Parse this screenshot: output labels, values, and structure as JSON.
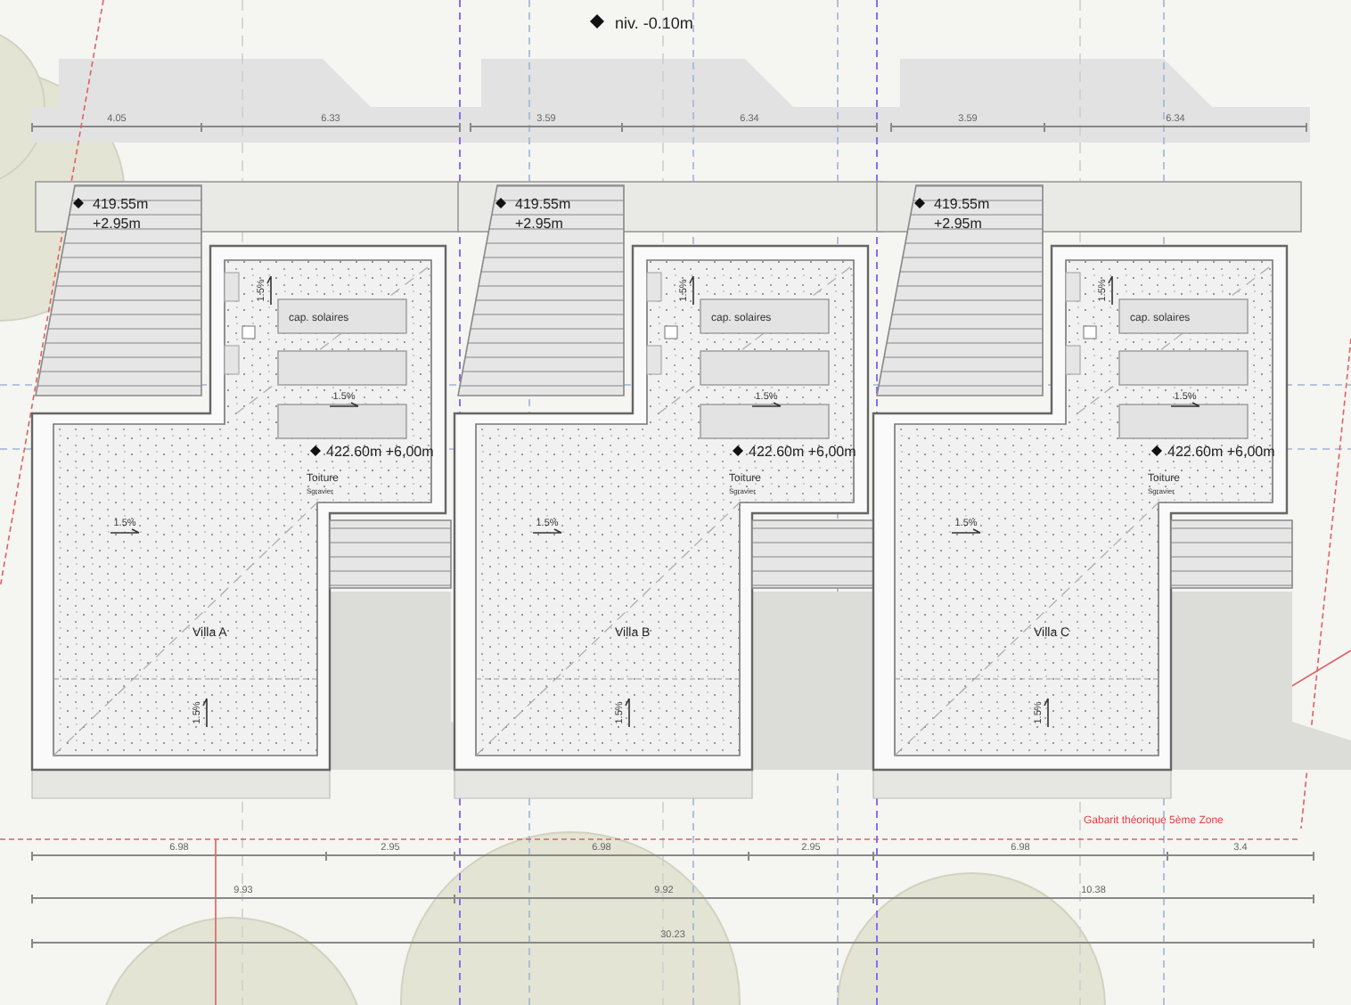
{
  "level_marker": {
    "text": "niv. -0.10m"
  },
  "top_dimensions": [
    "4.05",
    "6.33",
    "3.59",
    "6.34",
    "3.59",
    "6.34"
  ],
  "villas": [
    {
      "name": "Villa A",
      "terrace_level": "419.55m",
      "terrace_height": "+2.95m",
      "solar_label": "cap. solaires",
      "roof_level": "422.60m +6,00m",
      "roof_label": "Toiture",
      "roof_material": "Sgravier",
      "slopes": [
        "1.5%",
        "1.5%",
        "1.5%",
        "1.5%"
      ]
    },
    {
      "name": "Villa B",
      "terrace_level": "419.55m",
      "terrace_height": "+2.95m",
      "solar_label": "cap. solaires",
      "roof_level": "422.60m +6,00m",
      "roof_label": "Toiture",
      "roof_material": "Sgravier",
      "slopes": [
        "1.5%",
        "1.5%",
        "1.5%",
        "1.5%"
      ]
    },
    {
      "name": "Villa C",
      "terrace_level": "419.55m",
      "terrace_height": "+2.95m",
      "solar_label": "cap. solaires",
      "roof_level": "422.60m +6,00m",
      "roof_label": "Toiture",
      "roof_material": "Sgravier",
      "slopes": [
        "1.5%",
        "1.5%",
        "1.5%",
        "1.5%"
      ]
    }
  ],
  "bottom_dimensions": {
    "row_1": [
      "6.98",
      "2.95",
      "6.98",
      "2.95",
      "6.98",
      "3.4"
    ],
    "row_2": [
      "9.93",
      "9.92",
      "10.38"
    ],
    "row_3": [
      "30.23"
    ]
  },
  "zone_label": "Gabarit théorique 5ème Zone"
}
